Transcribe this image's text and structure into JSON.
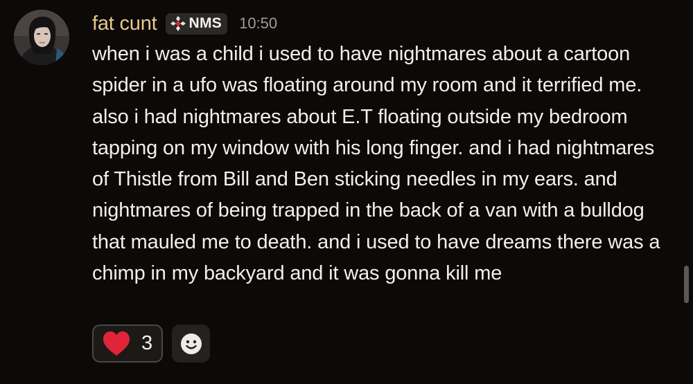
{
  "message": {
    "author": "fat cunt",
    "tag": {
      "icon": "diamond-cross-icon",
      "text": "NMS"
    },
    "timestamp": "10:50",
    "content": "when i was a child i used to have nightmares about a cartoon spider in a ufo was floating around my room and it terrified me. also i had nightmares about E.T floating outside my bedroom tapping on my window with his long finger. and i had nightmares of Thistle from Bill and Ben sticking needles in my ears. and nightmares of being trapped in the back of a van with a bulldog that mauled me to death. and i used to have dreams there was a chimp in my backyard and it was gonna kill me"
  },
  "reactions": [
    {
      "emoji": "heart-icon",
      "count": "3"
    }
  ],
  "add_reaction": {
    "icon": "smiley-icon"
  },
  "colors": {
    "background": "#0c0909",
    "username": "#e8c88a",
    "timestamp": "#a29c98",
    "text": "#f2f0ee",
    "heart": "#e0243a"
  }
}
